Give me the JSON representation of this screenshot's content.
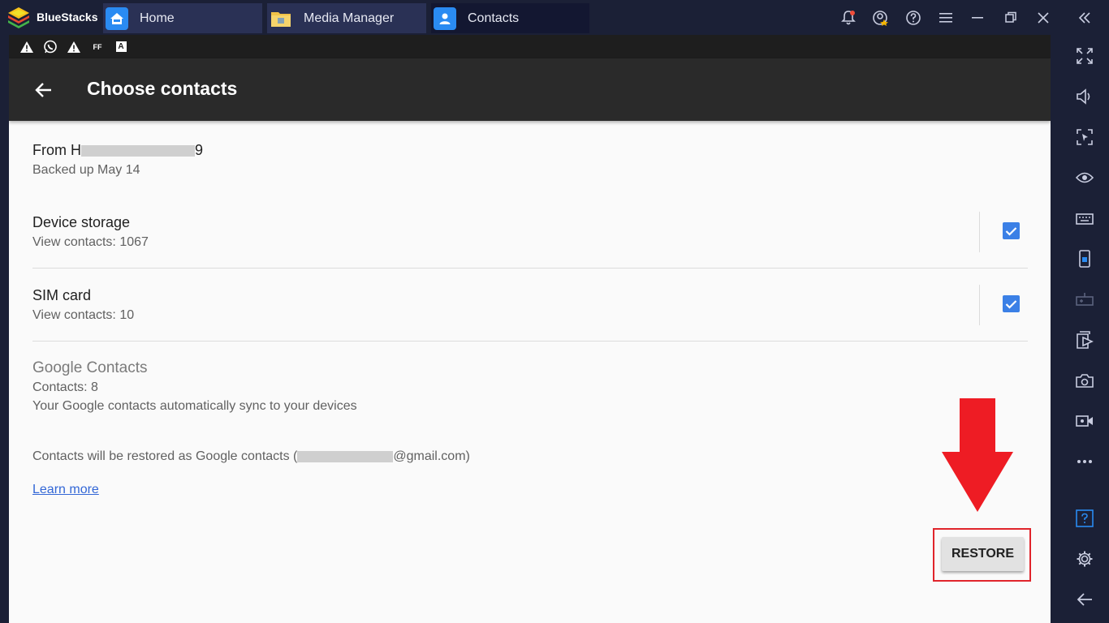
{
  "app": {
    "name": "BlueStacks"
  },
  "tabs": [
    {
      "label": "Home",
      "icon": "home-icon"
    },
    {
      "label": "Media Manager",
      "icon": "folder-icon"
    },
    {
      "label": "Contacts",
      "icon": "contact-icon",
      "active": true
    }
  ],
  "top_controls": [
    "bell-icon",
    "account-icon",
    "help-icon",
    "menu-icon",
    "minimize-icon",
    "restore-window-icon",
    "close-icon",
    "collapse-sidebar-icon"
  ],
  "status_icons": [
    "warning-icon",
    "whatsapp-icon",
    "warning-icon",
    "ff-icon",
    "a-icon"
  ],
  "status_text": {
    "ff": "FF",
    "a": "A"
  },
  "appbar": {
    "title": "Choose contacts"
  },
  "backup": {
    "title_prefix": "From H",
    "title_suffix": "9",
    "subtitle": "Backed up May 14"
  },
  "sources": [
    {
      "title": "Device storage",
      "subtitle": "View contacts: 1067",
      "checked": true
    },
    {
      "title": "SIM card",
      "subtitle": "View contacts: 10",
      "checked": true
    }
  ],
  "google": {
    "title": "Google Contacts",
    "count": "Contacts: 8",
    "description": "Your Google contacts automatically sync to your devices"
  },
  "restore_note": {
    "prefix": "Contacts will be restored as Google contacts (",
    "suffix": "@gmail.com)"
  },
  "learn_more": "Learn more",
  "restore_button": "RESTORE",
  "colors": {
    "accent": "#3b80e6",
    "annotation": "#e0242b",
    "chrome": "#1b2036"
  },
  "sidebar_icons": [
    "fullscreen-icon",
    "volume-icon",
    "screen-select-icon",
    "eye-icon",
    "keyboard-icon",
    "phone-icon",
    "gamepad-icon",
    "media-icon",
    "camera-icon",
    "video-record-icon",
    "more-icon",
    "help-box-icon",
    "settings-icon",
    "back-icon"
  ]
}
